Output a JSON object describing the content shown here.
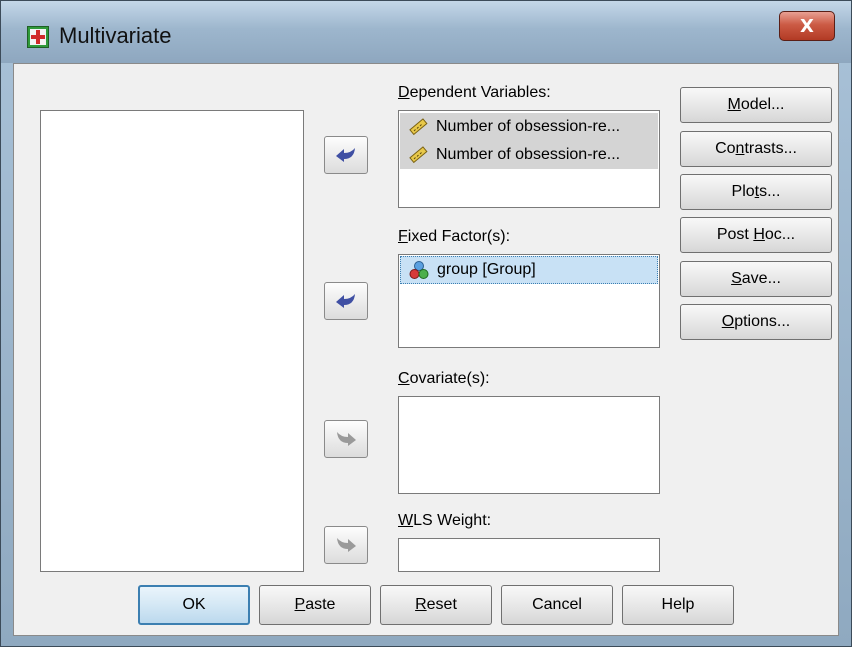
{
  "window": {
    "title": "Multivariate",
    "close_symbol": "X"
  },
  "dependent": {
    "label_prefix": "",
    "label_key": "D",
    "label_rest": "ependent Variables:",
    "items": [
      "Number of obsession-re...",
      "Number of obsession-re..."
    ]
  },
  "fixed": {
    "label_key": "F",
    "label_rest": "ixed Factor(s):",
    "items": [
      "group [Group]"
    ]
  },
  "covariate": {
    "label_key": "C",
    "label_rest": "ovariate(s):"
  },
  "wls": {
    "label_key": "W",
    "label_rest": "LS Weight:"
  },
  "side_buttons": {
    "model": {
      "pre": "",
      "key": "M",
      "post": "odel..."
    },
    "contrasts": {
      "pre": "Co",
      "key": "n",
      "post": "trasts..."
    },
    "plots": {
      "pre": "Plo",
      "key": "t",
      "post": "s..."
    },
    "posthoc": {
      "pre": "Post ",
      "key": "H",
      "post": "oc..."
    },
    "save": {
      "pre": "",
      "key": "S",
      "post": "ave..."
    },
    "options": {
      "pre": "",
      "key": "O",
      "post": "ptions..."
    }
  },
  "bottom_buttons": {
    "ok": {
      "pre": "OK",
      "key": "",
      "post": ""
    },
    "paste": {
      "pre": "",
      "key": "P",
      "post": "aste"
    },
    "reset": {
      "pre": "",
      "key": "R",
      "post": "eset"
    },
    "cancel": {
      "pre": "Cancel",
      "key": "",
      "post": ""
    },
    "help": {
      "pre": "Help",
      "key": "",
      "post": ""
    }
  },
  "colors": {
    "selection": "#c8e1f5",
    "selection_border": "#3c7fb1",
    "list_selected_gray": "#d4d4d4",
    "arrow_active": "#3f4fa3",
    "arrow_inactive": "#9a9a9a"
  },
  "icons": [
    "spss-dialog-icon",
    "close-icon",
    "scale-variable-icon",
    "nominal-variable-icon",
    "arrow-left-icon",
    "arrow-right-icon"
  ]
}
